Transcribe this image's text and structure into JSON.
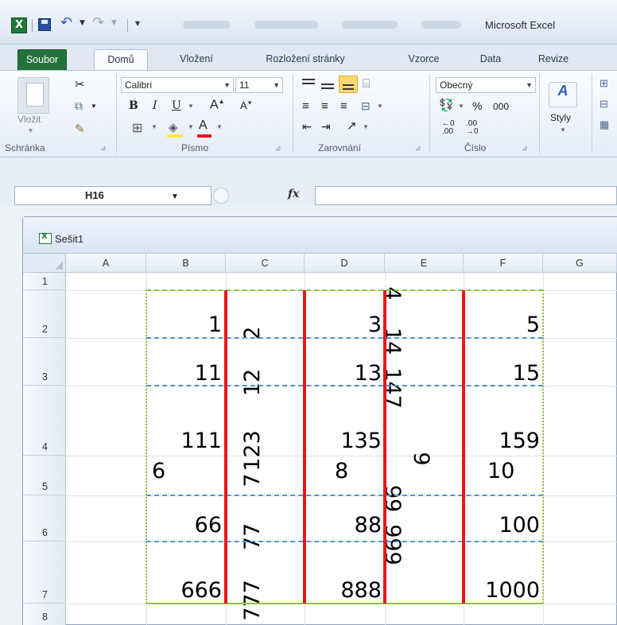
{
  "window_title": "Microsoft Excel",
  "tabs": [
    "Soubor",
    "Domů",
    "Vložení",
    "Rozložení stránky",
    "Vzorce",
    "Data",
    "Revize"
  ],
  "ribbon": {
    "paste_label": "Vložit",
    "font_name": "Calibri",
    "font_size": "11",
    "number_format": "Obecný",
    "percent": "%",
    "thousands": "000",
    "styles_label": "Styly",
    "groups": [
      "Schránka",
      "Písmo",
      "Zarovnání",
      "Číslo"
    ]
  },
  "formula_bar": {
    "name_box": "H16",
    "fx": "fx",
    "formula": ""
  },
  "workbook": {
    "name": "Sešit1",
    "columns": [
      "A",
      "B",
      "C",
      "D",
      "E",
      "F",
      "G"
    ],
    "rows": [
      "1",
      "2",
      "3",
      "4",
      "5",
      "6",
      "7",
      "8"
    ],
    "cells": {
      "B2": "1",
      "C2": "2",
      "D2": "3",
      "E2": "4",
      "F2": "5",
      "B3": "11",
      "C3": "12",
      "D3": "13",
      "E3": "14",
      "F3": "15",
      "B4": "111",
      "C4": "123",
      "D4": "135",
      "E4": "147",
      "F4": "159",
      "B5": "6",
      "C5": "7",
      "D5": "8",
      "E5": "9",
      "F5": "10",
      "B6": "66",
      "C6": "77",
      "D6": "88",
      "E6": "99",
      "F6": "100",
      "B7": "666",
      "C7": "777",
      "D7": "888",
      "E7": "999",
      "F7": "1000"
    }
  },
  "colors": {
    "file_tab": "#23733a",
    "border_red": "#e8161b",
    "border_blue_dashed": "#5b8fd0",
    "border_green": "#8cc63f",
    "highlight": "#fcd96d"
  }
}
